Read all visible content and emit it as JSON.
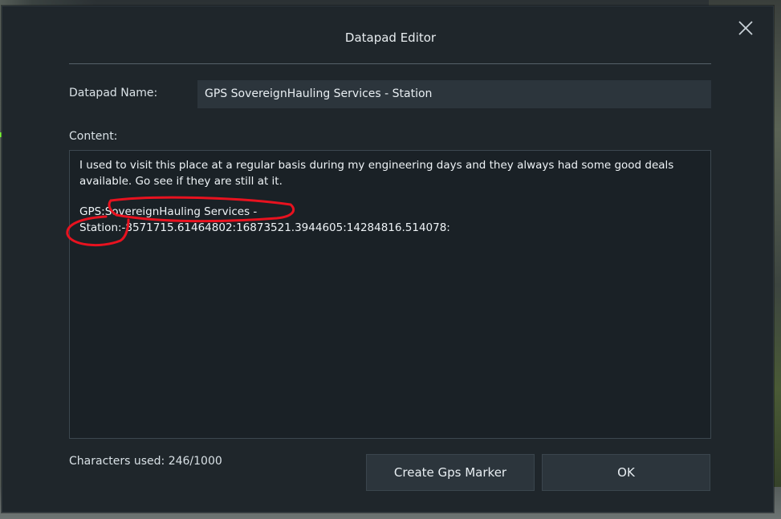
{
  "dialog": {
    "title": "Datapad Editor",
    "close_icon": "close-icon"
  },
  "name": {
    "label": "Datapad Name:",
    "value": "GPS SovereignHauling Services - Station"
  },
  "content": {
    "label": "Content:",
    "paragraph1": "I used to visit this place at a regular basis during my engineering days and they always had some good deals available. Go see if they are still at it.",
    "paragraph2": "GPS:SovereignHauling Services -\nStation:-8571715.61464802:16873521.3944605:14284816.514078:"
  },
  "footer": {
    "characters_used": "Characters used: 246/1000",
    "gps_button": "Create Gps Marker",
    "ok_button": "OK"
  },
  "colors": {
    "dialog_bg": "#1f262b",
    "field_bg": "#2c353c",
    "annotation": "#e8121f"
  }
}
